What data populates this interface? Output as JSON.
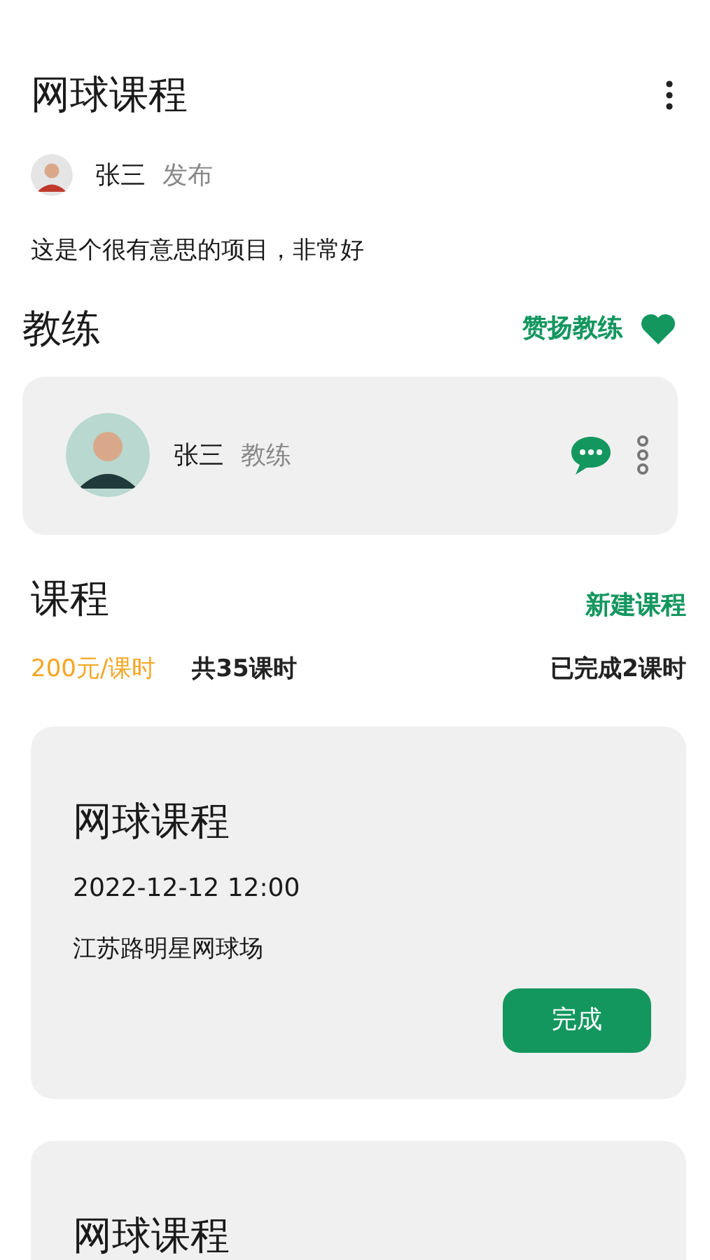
{
  "header": {
    "title": "网球课程"
  },
  "author": {
    "name": "张三",
    "action": "发布"
  },
  "description": "这是个很有意思的项目，非常好",
  "coach_section": {
    "title": "教练",
    "praise_label": "赞扬教练"
  },
  "coach": {
    "name": "张三",
    "role": "教练"
  },
  "course_section": {
    "title": "课程",
    "new_label": "新建课程",
    "price": "200元/课时",
    "total": "共35课时",
    "completed": "已完成2课时"
  },
  "courses": [
    {
      "title": "网球课程",
      "datetime": "2022-12-12 12:00",
      "location": "江苏路明星网球场",
      "button": "完成"
    },
    {
      "title": "网球课程"
    }
  ]
}
